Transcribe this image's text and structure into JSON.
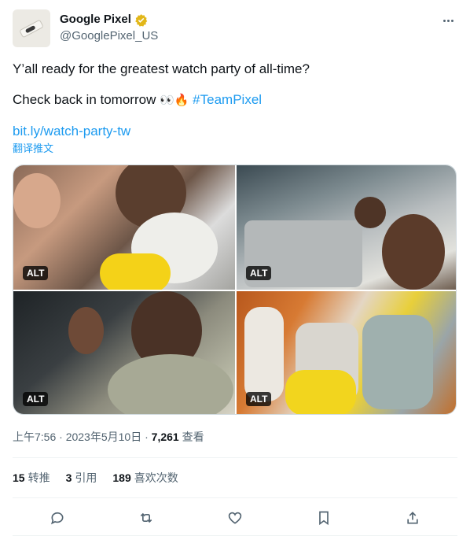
{
  "author": {
    "display_name": "Google Pixel",
    "handle": "@GooglePixel_US",
    "verified_color": "#e2b719",
    "avatar_icon": "pixel-phone-avatar"
  },
  "tweet": {
    "line1": "Y’all ready for the greatest watch party of all-time?",
    "line2_text": "Check back in tomorrow ",
    "line2_emoji": "👀🔥",
    "hashtag": "#TeamPixel",
    "link": "bit.ly/watch-party-tw",
    "translate": "翻译推文"
  },
  "media": {
    "photos": [
      {
        "alt_badge": "ALT"
      },
      {
        "alt_badge": "ALT"
      },
      {
        "alt_badge": "ALT"
      },
      {
        "alt_badge": "ALT"
      }
    ]
  },
  "meta": {
    "time": "上午7:56",
    "date": "2023年5月10日",
    "views_count": "7,261",
    "views_label": "查看",
    "separator": " · "
  },
  "stats": {
    "retweets_count": "15",
    "retweets_label": "转推",
    "quotes_count": "3",
    "quotes_label": "引用",
    "likes_count": "189",
    "likes_label": "喜欢次数"
  },
  "colors": {
    "link": "#1d9bf0",
    "text": "#0f1419",
    "secondary": "#536471"
  },
  "actions": [
    "reply-icon",
    "retweet-icon",
    "like-icon",
    "bookmark-icon",
    "share-icon"
  ]
}
